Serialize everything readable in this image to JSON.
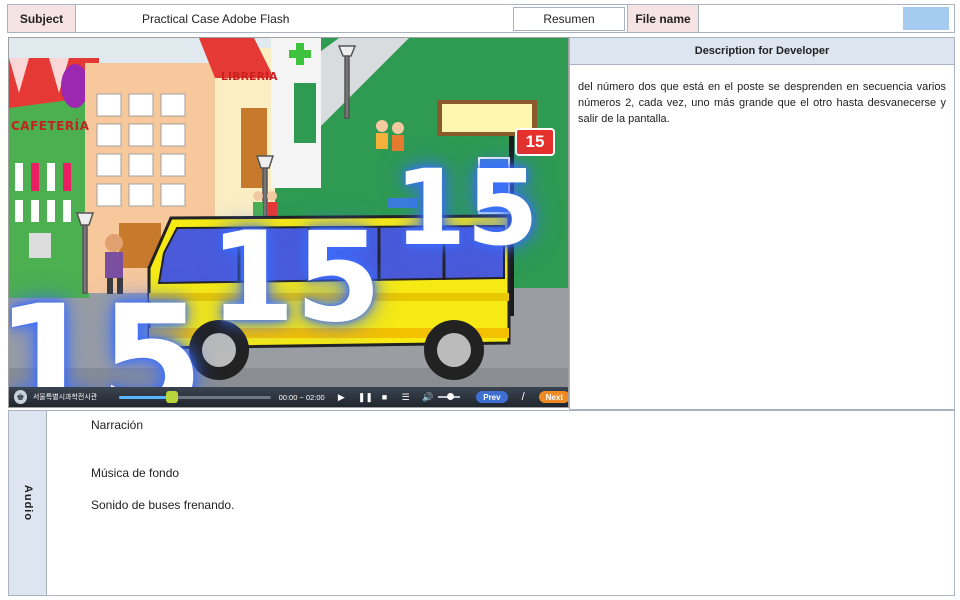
{
  "header": {
    "subject_label": "Subject",
    "subject_value": "Practical Case Adobe Flash",
    "resumen_label": "Resumen",
    "filename_label": "File name",
    "filename_value": "",
    "swatch_color": "#a6cbf1"
  },
  "scene": {
    "cafe_sign": "CAFETERÍA",
    "libreria_sign": "LIBRERÍA",
    "badge": "15",
    "numbers": [
      "15",
      "15",
      "15"
    ],
    "player": {
      "org": "서울특별시과학전시관",
      "time": "00:00 ~ 02:00",
      "progress_fraction": 0.35,
      "volume_fraction": 0.55,
      "play_icon": "▶",
      "pause_icon": "❚❚",
      "stop_icon": "■",
      "list_icon": "☰",
      "volume_icon": "🔊",
      "prev": "Prev",
      "separator": "/",
      "next": "Next"
    }
  },
  "developer": {
    "title": "Description for Developer",
    "text": "del número dos que está en el poste se desprenden en secuencia varios números 2, cada vez, uno más grande que el otro hasta desvanecerse y salir de la pantalla."
  },
  "audio": {
    "tab_label": "Audio",
    "narration": "Narración",
    "music": "Música de fondo",
    "sfx": "Sonido de buses frenando."
  }
}
